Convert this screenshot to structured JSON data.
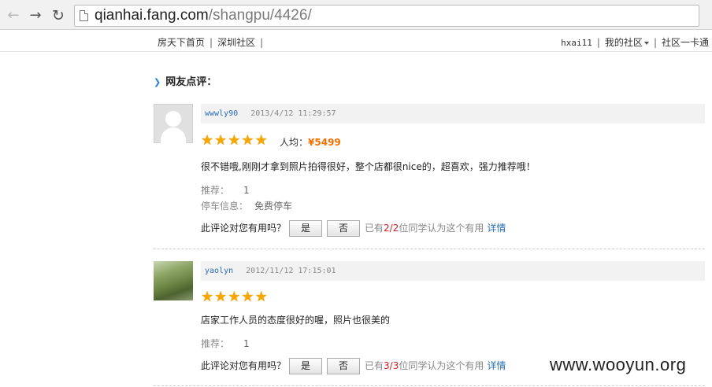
{
  "browser": {
    "url_host": "qianhai.fang.com",
    "url_path": "/shangpu/4426/"
  },
  "topnav": {
    "left_items": [
      "房天下首页",
      "深圳社区"
    ],
    "user": "hxai11",
    "my_community": "我的社区",
    "community_card": "社区一卡通"
  },
  "section": {
    "title": "网友点评："
  },
  "reviews": [
    {
      "username": "wwwly90",
      "timestamp": "2013/4/12 11:29:57",
      "rating": 5,
      "avg_label": "人均：",
      "avg_price": "¥5499",
      "content": "很不错哦,刚刚才拿到照片拍得很好，整个店都很nice的，超喜欢，强力推荐哦！",
      "recommend_label": "推荐：",
      "recommend_value": "1",
      "parking_label": "停车信息：",
      "parking_value": "免费停车",
      "useful_question": "此评论对您有用吗？",
      "yes_label": "是",
      "no_label": "否",
      "stat_prefix": "已有",
      "stat_count": "2/2",
      "stat_suffix": "位同学认为这个有用",
      "detail_label": "详情"
    },
    {
      "username": "yaolyn",
      "timestamp": "2012/11/12 17:15:01",
      "rating": 5,
      "content": "店家工作人员的态度很好的喔，照片也很美的",
      "recommend_label": "推荐：",
      "recommend_value": "1",
      "useful_question": "此评论对您有用吗？",
      "yes_label": "是",
      "no_label": "否",
      "stat_prefix": "已有",
      "stat_count": "3/3",
      "stat_suffix": "位同学认为这个有用",
      "detail_label": "详情"
    }
  ],
  "watermark": "www.wooyun.org",
  "colors": {
    "link": "#2a6fb5",
    "price": "#f07000",
    "star": "#f6a800",
    "count": "#d02020"
  }
}
